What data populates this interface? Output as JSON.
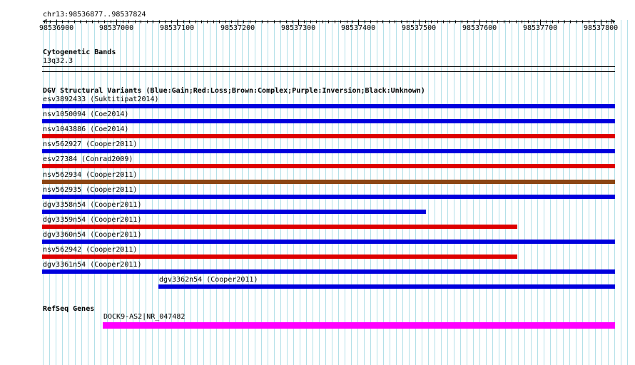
{
  "ruler": {
    "location": "chr13:98536877..98537824",
    "ticks": [
      "98536900",
      "98537000",
      "98537100",
      "98537200",
      "98537300",
      "98537400",
      "98537500",
      "98537600",
      "98537700",
      "98537800"
    ]
  },
  "cytoband": {
    "title": "Cytogenetic Bands",
    "band": "13q32.3"
  },
  "dgv": {
    "title": "DGV Structural Variants (Blue:Gain;Red:Loss;Brown:Complex;Purple:Inversion;Black:Unknown)",
    "type_colors": {
      "gain": "#0000dd",
      "loss": "#dd0000",
      "complex": "#8b4513",
      "inversion": "#800080",
      "unknown": "#000000"
    },
    "variants": [
      {
        "label": "esv3892433 (Suktitipat2014)",
        "type": "gain",
        "start": 98536877,
        "end": 98537824
      },
      {
        "label": "nsv1050094 (Coe2014)",
        "type": "gain",
        "start": 98536877,
        "end": 98537824
      },
      {
        "label": "nsv1043886 (Coe2014)",
        "type": "loss",
        "start": 98536877,
        "end": 98537824
      },
      {
        "label": "nsv562927 (Cooper2011)",
        "type": "gain",
        "start": 98536877,
        "end": 98537824
      },
      {
        "label": "esv27384 (Conrad2009)",
        "type": "loss",
        "start": 98536877,
        "end": 98537824
      },
      {
        "label": "nsv562934 (Cooper2011)",
        "type": "complex",
        "start": 98536877,
        "end": 98537824
      },
      {
        "label": "nsv562935 (Cooper2011)",
        "type": "gain",
        "start": 98536877,
        "end": 98537824
      },
      {
        "label": "dgv3358n54 (Cooper2011)",
        "type": "gain",
        "start": 98536877,
        "end": 98537511
      },
      {
        "label": "dgv3359n54 (Cooper2011)",
        "type": "loss",
        "start": 98536877,
        "end": 98537663
      },
      {
        "label": "dgv3360n54 (Cooper2011)",
        "type": "gain",
        "start": 98536877,
        "end": 98537824
      },
      {
        "label": "nsv562942 (Cooper2011)",
        "type": "loss",
        "start": 98536877,
        "end": 98537663
      },
      {
        "label": "dgv3361n54 (Cooper2011)",
        "type": "gain",
        "start": 98536877,
        "end": 98537824
      },
      {
        "label": "dgv3362n54 (Cooper2011)",
        "type": "gain",
        "start": 98537069,
        "end": 98537824
      }
    ]
  },
  "refseq": {
    "title": "RefSeq Genes",
    "color": "#ff00ff",
    "genes": [
      {
        "label": "DOCK9-AS2|NR_047482",
        "start": 98536977,
        "end": 98537824
      }
    ]
  }
}
